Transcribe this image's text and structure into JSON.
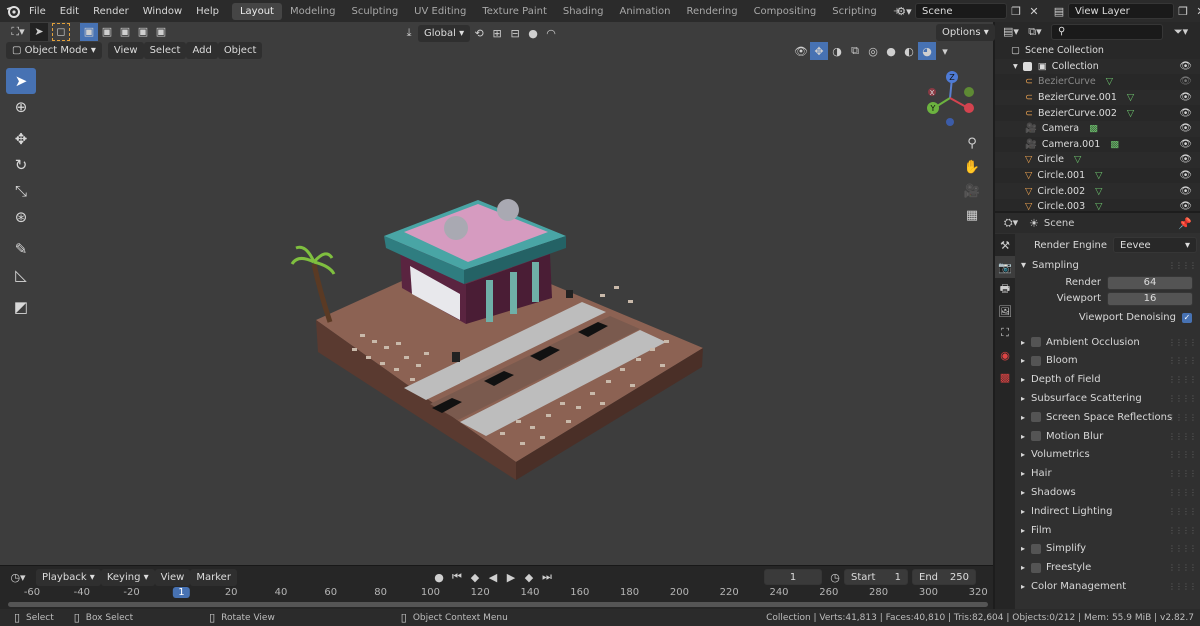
{
  "menubar": {
    "items": [
      "File",
      "Edit",
      "Render",
      "Window",
      "Help"
    ],
    "workspaces": [
      "Layout",
      "Modeling",
      "Sculpting",
      "UV Editing",
      "Texture Paint",
      "Shading",
      "Animation",
      "Rendering",
      "Compositing",
      "Scripting"
    ],
    "add_tab": "+",
    "scene": "Scene",
    "view_layer": "View Layer"
  },
  "viewport_header": {
    "mode": "Object Mode",
    "menus": [
      "View",
      "Select",
      "Add",
      "Object"
    ],
    "transform": "Global",
    "options": "Options"
  },
  "gizmo": {
    "x": "X",
    "y": "Y",
    "z": "Z"
  },
  "outliner": {
    "search_placeholder": "",
    "root": "Scene Collection",
    "collection": "Collection",
    "items": [
      {
        "name": "BezierCurve",
        "icon": "curve-icon",
        "dim": true
      },
      {
        "name": "BezierCurve.001",
        "icon": "curve-icon",
        "dim": false
      },
      {
        "name": "BezierCurve.002",
        "icon": "curve-icon",
        "dim": false
      },
      {
        "name": "Camera",
        "icon": "camera-icon",
        "dim": false
      },
      {
        "name": "Camera.001",
        "icon": "camera-icon",
        "dim": false
      },
      {
        "name": "Circle",
        "icon": "mesh-icon",
        "dim": false
      },
      {
        "name": "Circle.001",
        "icon": "mesh-icon",
        "dim": false
      },
      {
        "name": "Circle.002",
        "icon": "mesh-icon",
        "dim": false
      },
      {
        "name": "Circle.003",
        "icon": "mesh-icon",
        "dim": false
      }
    ]
  },
  "properties": {
    "context": "Scene",
    "render_engine_label": "Render Engine",
    "render_engine": "Eevee",
    "sampling": "Sampling",
    "render_label": "Render",
    "render_value": "64",
    "viewport_label": "Viewport",
    "viewport_value": "16",
    "denoise_label": "Viewport Denoising",
    "panels": [
      {
        "label": "Ambient Occlusion",
        "checkbox": true
      },
      {
        "label": "Bloom",
        "checkbox": true
      },
      {
        "label": "Depth of Field",
        "checkbox": false
      },
      {
        "label": "Subsurface Scattering",
        "checkbox": false
      },
      {
        "label": "Screen Space Reflections",
        "checkbox": true
      },
      {
        "label": "Motion Blur",
        "checkbox": true
      },
      {
        "label": "Volumetrics",
        "checkbox": false
      },
      {
        "label": "Hair",
        "checkbox": false
      },
      {
        "label": "Shadows",
        "checkbox": false
      },
      {
        "label": "Indirect Lighting",
        "checkbox": false
      },
      {
        "label": "Film",
        "checkbox": false
      },
      {
        "label": "Simplify",
        "checkbox": true
      },
      {
        "label": "Freestyle",
        "checkbox": true
      },
      {
        "label": "Color Management",
        "checkbox": false
      }
    ]
  },
  "timeline": {
    "menus": [
      "Playback",
      "Keying",
      "View",
      "Marker"
    ],
    "current_frame": "1",
    "start_label": "Start",
    "start": "1",
    "end_label": "End",
    "end": "250",
    "ticks": [
      "-60",
      "-40",
      "-20",
      "1",
      "20",
      "40",
      "60",
      "80",
      "100",
      "120",
      "140",
      "160",
      "180",
      "200",
      "220",
      "240",
      "260",
      "280",
      "300",
      "320"
    ]
  },
  "statusbar": {
    "select": "Select",
    "box_select": "Box Select",
    "rotate_view": "Rotate View",
    "context_menu": "Object Context Menu",
    "stats": "Collection | Verts:41,813 | Faces:40,810 | Tris:82,604 | Objects:0/212 | Mem: 55.9 MiB | v2.82.7"
  },
  "colors": {
    "accent": "#4772b3",
    "viewport": "#3d3d3d",
    "panel": "#303030"
  }
}
